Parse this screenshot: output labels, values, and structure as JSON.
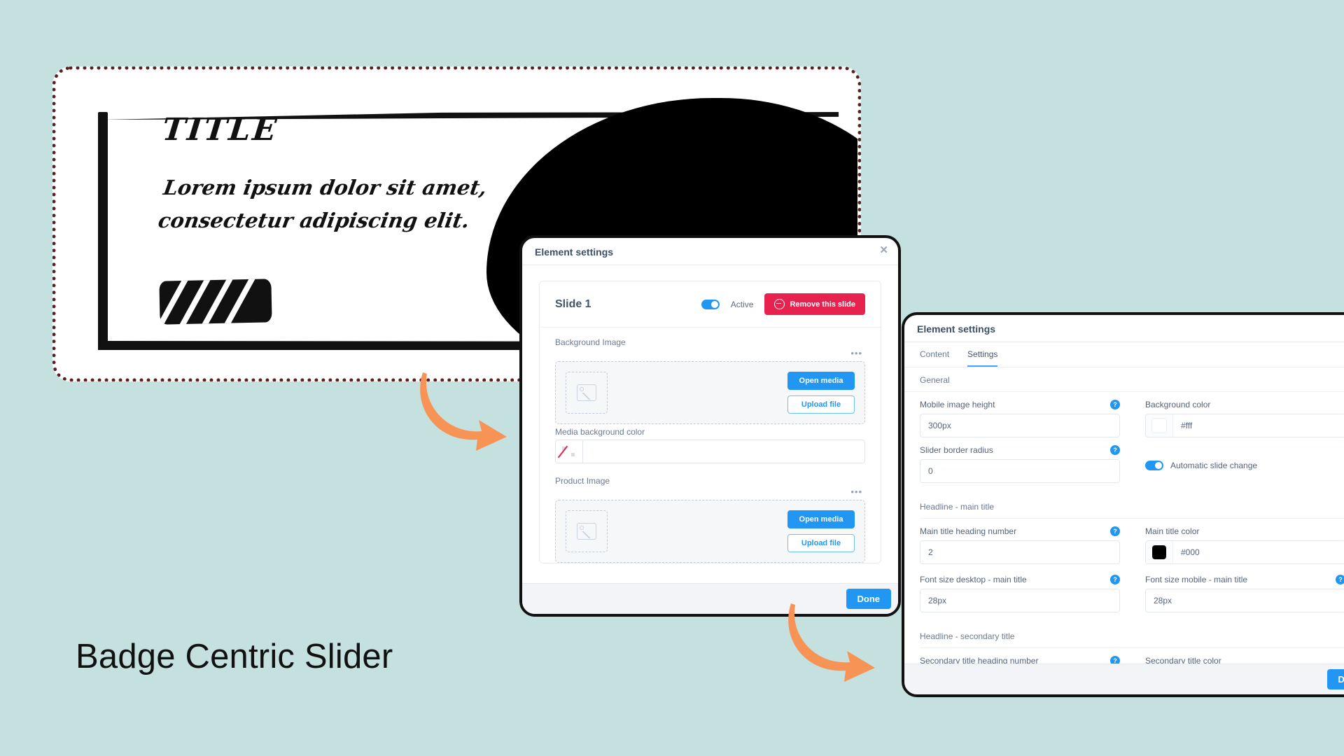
{
  "page": {
    "background_color": "#c4e0df",
    "caption": "Badge Centric Slider"
  },
  "hero": {
    "title": "TITLE",
    "body": "Lorem ipsum dolor sit amet, consectetur adipiscing elit."
  },
  "left_dialog": {
    "header_title": "Element settings",
    "close_label": "✕",
    "slide": {
      "title": "Slide 1",
      "toggle_label": "Active",
      "remove_label": "Remove this slide"
    },
    "background_image": {
      "label": "Background Image",
      "menu_dots": "•••",
      "open_media_label": "Open media",
      "upload_label": "Upload file"
    },
    "media_background_color": {
      "label": "Media background color",
      "value": ""
    },
    "product_image": {
      "label": "Product Image",
      "menu_dots": "•••",
      "open_media_label": "Open media",
      "upload_label": "Upload file"
    },
    "done_label": "Done"
  },
  "right_dialog": {
    "header_title": "Element settings",
    "tabs": [
      {
        "label": "Content",
        "active": false
      },
      {
        "label": "Settings",
        "active": true
      }
    ],
    "sections": [
      {
        "title": "General",
        "fields": [
          {
            "label": "Mobile image height",
            "value": "300px",
            "help": "?",
            "type": "text"
          },
          {
            "label": "Background color",
            "value": "#fff",
            "swatch": "#ffffff",
            "type": "color"
          },
          {
            "label": "Slider border radius",
            "value": "0",
            "help": "?",
            "type": "text"
          },
          {
            "label": "Automatic slide change",
            "value": "on",
            "type": "toggle"
          }
        ]
      },
      {
        "title": "Headline - main title",
        "fields": [
          {
            "label": "Main title heading number",
            "value": "2",
            "help": "?",
            "type": "text"
          },
          {
            "label": "Main title color",
            "value": "#000",
            "swatch": "#000000",
            "type": "color"
          },
          {
            "label": "Font size desktop - main title",
            "value": "28px",
            "help": "?",
            "type": "text"
          },
          {
            "label": "Font size mobile - main title",
            "value": "28px",
            "help": "?",
            "type": "text"
          }
        ]
      },
      {
        "title": "Headline - secondary title",
        "fields": [
          {
            "label": "Secondary title heading number",
            "value": "",
            "help": "?",
            "type": "text"
          },
          {
            "label": "Secondary title color",
            "value": "",
            "type": "text"
          }
        ]
      }
    ],
    "done_label": "Done"
  },
  "colors": {
    "accent_blue": "#2196f3",
    "danger_red": "#e8224f",
    "arrow_orange": "#f79455",
    "dotted_border": "#5a1f1f"
  }
}
